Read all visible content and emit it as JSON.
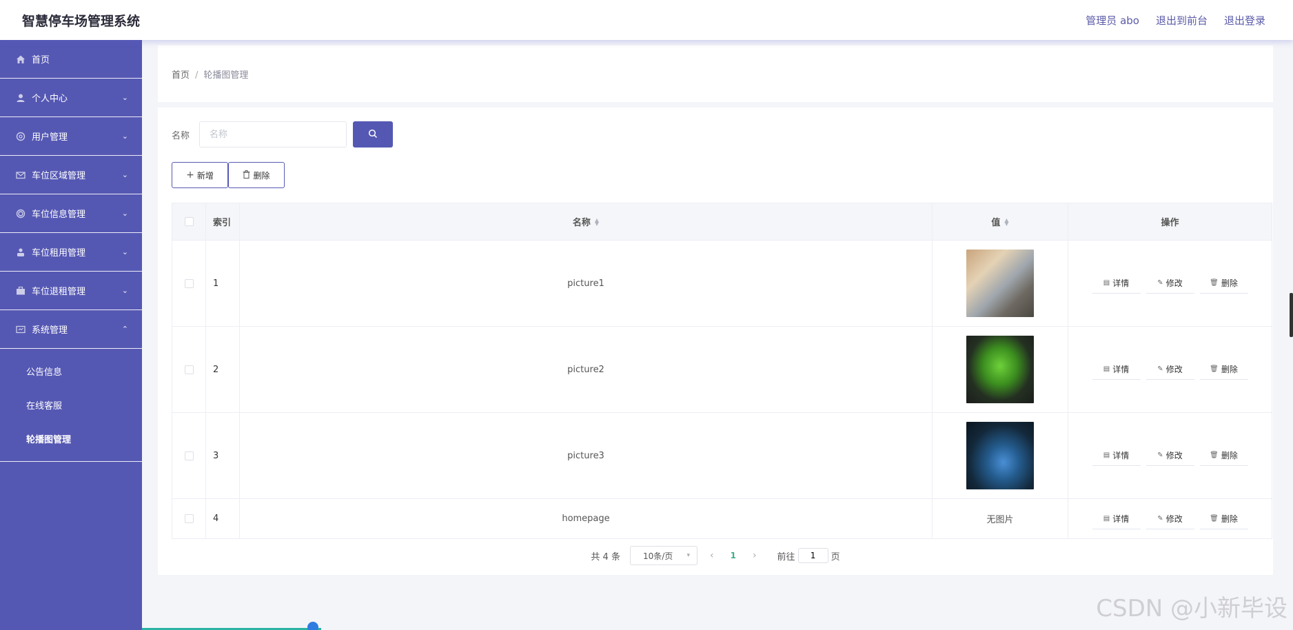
{
  "header": {
    "title": "智慧停车场管理系统",
    "admin": "管理员 abo",
    "to_front": "退出到前台",
    "logout": "退出登录"
  },
  "sidebar": {
    "items": [
      {
        "label": "首页",
        "icon": "home-icon"
      },
      {
        "label": "个人中心",
        "icon": "user-icon"
      },
      {
        "label": "用户管理",
        "icon": "users-icon"
      },
      {
        "label": "车位区域管理",
        "icon": "mail-icon"
      },
      {
        "label": "车位信息管理",
        "icon": "ring-icon"
      },
      {
        "label": "车位租用管理",
        "icon": "person-icon"
      },
      {
        "label": "车位退租管理",
        "icon": "briefcase-icon"
      },
      {
        "label": "系统管理",
        "icon": "settings-icon"
      }
    ],
    "sub_items": [
      "公告信息",
      "在线客服",
      "轮播图管理"
    ]
  },
  "breadcrumb": {
    "home": "首页",
    "separator": "/",
    "current": "轮播图管理"
  },
  "search": {
    "label": "名称",
    "placeholder": "名称"
  },
  "toolbar": {
    "add_label": "新增",
    "delete_label": "删除"
  },
  "table": {
    "headers": {
      "index": "索引",
      "name": "名称",
      "value": "值",
      "actions": "操作"
    },
    "rows": [
      {
        "index": "1",
        "name": "picture1",
        "value": "",
        "has_image": true
      },
      {
        "index": "2",
        "name": "picture2",
        "value": "",
        "has_image": true
      },
      {
        "index": "3",
        "name": "picture3",
        "value": "",
        "has_image": true
      },
      {
        "index": "4",
        "name": "homepage",
        "value": "无图片",
        "has_image": false
      }
    ],
    "actions": {
      "detail": "详情",
      "edit": "修改",
      "delete": "删除"
    }
  },
  "pagination": {
    "total": "共 4 条",
    "page_size": "10条/页",
    "current_page": "1",
    "goto_label": "前往",
    "goto_value": "1",
    "page_suffix": "页"
  },
  "watermark": "CSDN @小新毕设",
  "colors": {
    "primary": "#5558b3",
    "active_page": "#3eaf8a"
  }
}
